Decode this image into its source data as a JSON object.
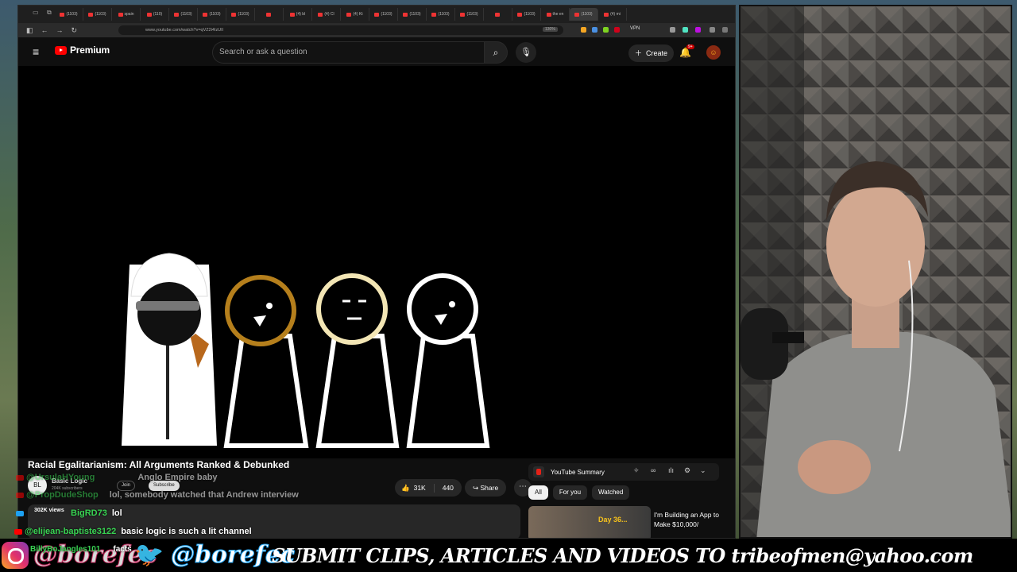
{
  "browser": {
    "tabs": [
      "(1103)",
      "(1103)",
      "spain",
      "(110)",
      "(1103)",
      "(1103)",
      "(1103)",
      "",
      "(4) bl",
      "(4) Cl",
      "(4) Kt",
      "(1103)",
      "(1103)",
      "(1103)",
      "(1103)",
      "",
      "(1103)",
      "the en",
      "(1103)",
      "(4) mi"
    ],
    "active_tab": 18,
    "url": "www.youtube.com/watch?v=qVZ2i4IzUlI",
    "zoom": "130%",
    "vpn": "VPN"
  },
  "youtube": {
    "brand": "Premium",
    "search_placeholder": "Search or ask a question",
    "create_label": "Create",
    "notifications": "9+",
    "video": {
      "title": "Racial Egalitarianism: All Arguments Ranked & Debunked",
      "channel": "Basic Logic",
      "subscribers": "204K subscribers",
      "join_label": "Join",
      "subscribe_label": "Subscribe",
      "likes": "31K",
      "comments": "440",
      "share_label": "Share",
      "views": "302K views"
    },
    "summary": {
      "label": "YouTube Summary"
    },
    "chips": [
      "All",
      "For you",
      "Watched"
    ],
    "recommendation": {
      "title": "I'm Building an App to Make $10,000/",
      "badge": "Day 36..."
    }
  },
  "chat": [
    {
      "user": "@UrsulaHYoung",
      "message": "Anglo Empire baby"
    },
    {
      "user": "@PropDudeShop",
      "message": "lol, somebody watched that Andrew interview"
    },
    {
      "user": "BigRD73",
      "message": "lol"
    },
    {
      "user": "@elijean-baptiste3122",
      "message": "basic logic is such a lit channel"
    },
    {
      "user": "BillyBoJangles101",
      "message": "facts"
    }
  ],
  "banner": {
    "instagram": "@borefec",
    "twitter": "@borefec",
    "cta": "SUBMIT CLIPS, ARTICLES AND VIDEOS TO tribeofmen@yahoo.com"
  }
}
